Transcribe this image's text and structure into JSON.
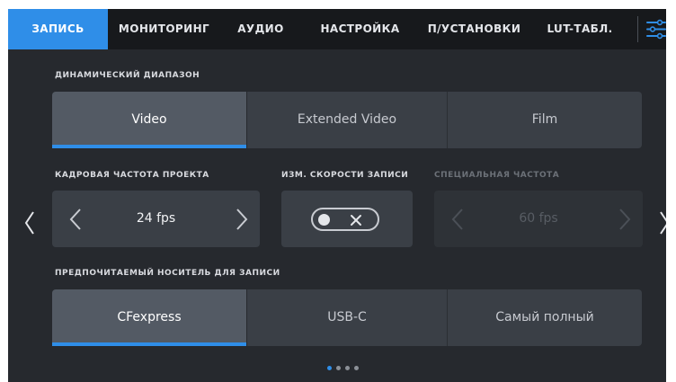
{
  "tabs": [
    {
      "label": "ЗАПИСЬ",
      "active": true
    },
    {
      "label": "МОНИТОРИНГ",
      "active": false
    },
    {
      "label": "АУДИО",
      "active": false
    },
    {
      "label": "НАСТРОЙКА",
      "active": false
    },
    {
      "label": "П/УСТАНОВКИ",
      "active": false
    },
    {
      "label": "LUT-ТАБЛ.",
      "active": false
    }
  ],
  "menu_icon": "sliders-icon",
  "dynamic_range": {
    "label": "ДИНАМИЧЕСКИЙ ДИАПАЗОН",
    "options": [
      "Video",
      "Extended Video",
      "Film"
    ],
    "selected": "Video"
  },
  "frame_rate": {
    "label": "КАДРОВАЯ ЧАСТОТА ПРОЕКТА",
    "value": "24 fps"
  },
  "off_speed": {
    "label": "ИЗМ. СКОРОСТИ ЗАПИСИ",
    "enabled": false
  },
  "special_rate": {
    "label": "СПЕЦИАЛЬНАЯ ЧАСТОТА",
    "value": "60 fps",
    "disabled": true
  },
  "media": {
    "label": "ПРЕДПОЧИТАЕМЫЙ НОСИТЕЛЬ ДЛЯ ЗАПИСИ",
    "options": [
      "CFexpress",
      "USB-C",
      "Самый полный"
    ],
    "selected": "CFexpress"
  },
  "pagination": {
    "pages": 4,
    "current": 1
  },
  "colors": {
    "accent": "#2f8ee8",
    "tabbar": "#17191c",
    "background": "#26292e",
    "button": "#3a3f46",
    "button_active": "#535a64"
  }
}
